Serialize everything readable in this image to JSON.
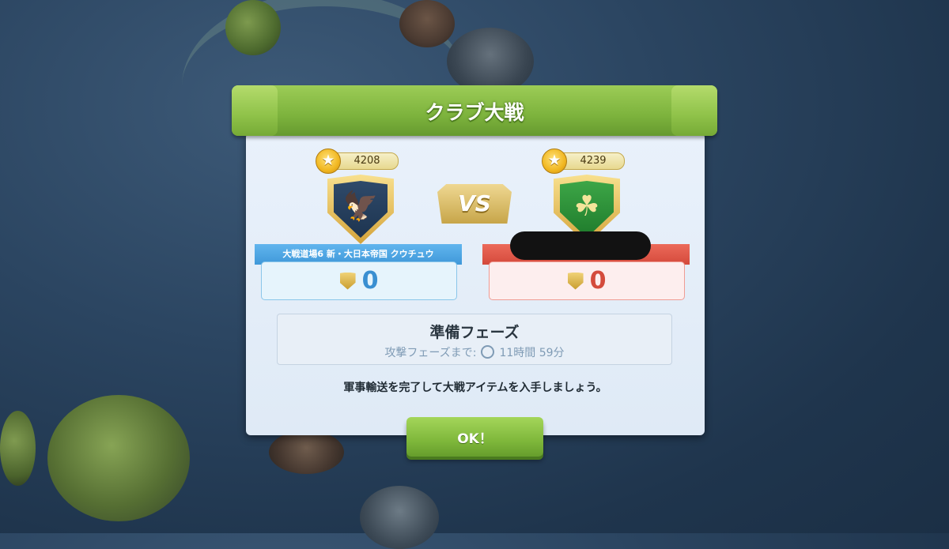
{
  "dialog": {
    "title": "クラブ大戦",
    "vs_label": "VS",
    "left_clan": {
      "score": "4208",
      "name": "大戦道場6 新・大日本帝国 クウチュウ",
      "points": "0",
      "emblem_icon": "eagle-icon",
      "ribbon_color": "#4aa3e0"
    },
    "right_clan": {
      "score": "4239",
      "name": "",
      "points": "0",
      "emblem_icon": "clover-icon",
      "ribbon_color": "#dd5444"
    },
    "phase": {
      "title": "準備フェーズ",
      "timer_label": "攻撃フェーズまで:",
      "timer_value": "11時間 59分"
    },
    "message": "軍事輸送を完了して大戦アイテムを入手しましょう。",
    "ok_button": "OK！"
  }
}
